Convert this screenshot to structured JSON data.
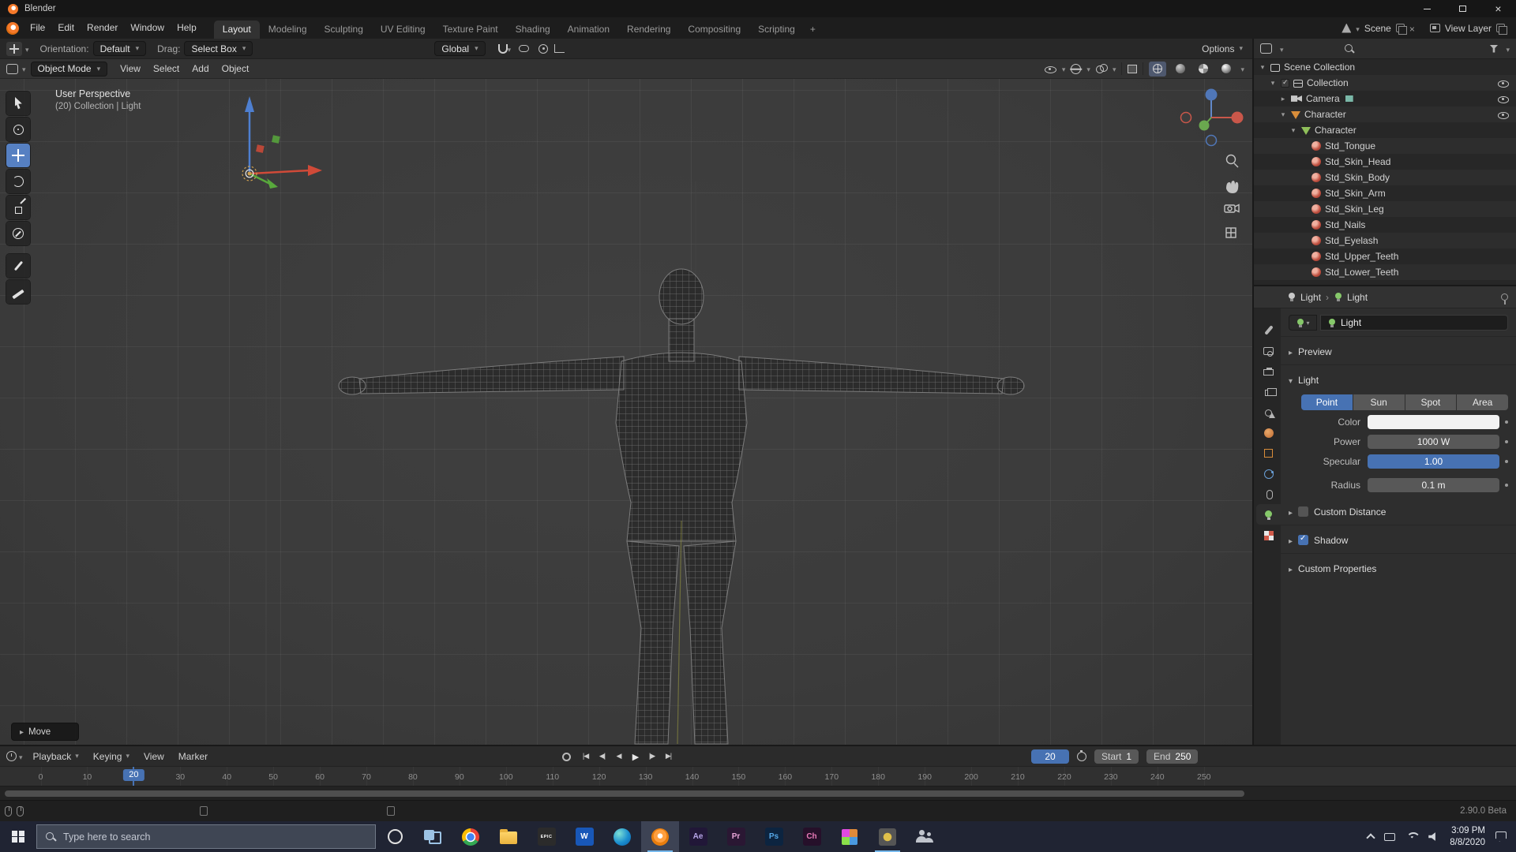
{
  "window": {
    "title": "Blender"
  },
  "topbar": {
    "menus": [
      "File",
      "Edit",
      "Render",
      "Window",
      "Help"
    ],
    "tabs": [
      "Layout",
      "Modeling",
      "Sculpting",
      "UV Editing",
      "Texture Paint",
      "Shading",
      "Animation",
      "Rendering",
      "Compositing",
      "Scripting"
    ],
    "active_tab": "Layout",
    "add_tab": "+",
    "scene_label": "Scene",
    "view_layer_label": "View Layer"
  },
  "tool_settings": {
    "orientation_label": "Orientation:",
    "orientation_value": "Default",
    "drag_label": "Drag:",
    "drag_value": "Select Box",
    "transform_orientation": "Global",
    "options_label": "Options"
  },
  "viewport_header": {
    "mode": "Object Mode",
    "menus": [
      "View",
      "Select",
      "Add",
      "Object"
    ]
  },
  "viewport": {
    "perspective_label": "User Perspective",
    "context_label": "(20) Collection | Light",
    "operator_panel_label": "Move"
  },
  "tools": [
    {
      "name": "select-box-tool",
      "active": false
    },
    {
      "name": "cursor-tool",
      "active": false
    },
    {
      "name": "move-tool",
      "active": true
    },
    {
      "name": "rotate-tool",
      "active": false
    },
    {
      "name": "scale-tool",
      "active": false
    },
    {
      "name": "transform-tool",
      "active": false
    },
    {
      "name": "annotate-tool",
      "active": false
    },
    {
      "name": "measure-tool",
      "active": false
    }
  ],
  "outliner": {
    "rows": [
      {
        "label": "Scene Collection",
        "depth": 0,
        "icon": "scene-collection",
        "caret": "down",
        "eye": false
      },
      {
        "label": "Collection",
        "depth": 1,
        "icon": "collection",
        "caret": "down",
        "eye": true,
        "checkbox": true
      },
      {
        "label": "Camera",
        "depth": 2,
        "icon": "camera",
        "caret": "right",
        "eye": true,
        "badge": true
      },
      {
        "label": "Character",
        "depth": 2,
        "icon": "collection-orange",
        "caret": "down",
        "eye": true
      },
      {
        "label": "Character",
        "depth": 3,
        "icon": "mesh-green",
        "caret": "down",
        "eye": false
      },
      {
        "label": "Std_Tongue",
        "depth": 4,
        "icon": "material",
        "eye": false
      },
      {
        "label": "Std_Skin_Head",
        "depth": 4,
        "icon": "material",
        "eye": false
      },
      {
        "label": "Std_Skin_Body",
        "depth": 4,
        "icon": "material",
        "eye": false
      },
      {
        "label": "Std_Skin_Arm",
        "depth": 4,
        "icon": "material",
        "eye": false
      },
      {
        "label": "Std_Skin_Leg",
        "depth": 4,
        "icon": "material",
        "eye": false
      },
      {
        "label": "Std_Nails",
        "depth": 4,
        "icon": "material",
        "eye": false
      },
      {
        "label": "Std_Eyelash",
        "depth": 4,
        "icon": "material",
        "eye": false
      },
      {
        "label": "Std_Upper_Teeth",
        "depth": 4,
        "icon": "material",
        "eye": false
      },
      {
        "label": "Std_Lower_Teeth",
        "depth": 4,
        "icon": "material",
        "eye": false
      }
    ]
  },
  "properties": {
    "tabs": [
      {
        "name": "tool",
        "active": false
      },
      {
        "name": "render",
        "active": false
      },
      {
        "name": "output",
        "active": false
      },
      {
        "name": "view-layer",
        "active": false
      },
      {
        "name": "scene",
        "active": false
      },
      {
        "name": "world",
        "active": false
      },
      {
        "name": "object",
        "active": false
      },
      {
        "name": "physics",
        "active": false
      },
      {
        "name": "constraints",
        "active": false
      },
      {
        "name": "object-data",
        "active": true
      },
      {
        "name": "texture",
        "active": false
      }
    ],
    "breadcrumb_first": "Light",
    "breadcrumb_second": "Light",
    "name_value": "Light",
    "preview_section": "Preview",
    "light_section": "Light",
    "light_types": [
      {
        "label": "Point",
        "active": true
      },
      {
        "label": "Sun",
        "active": false
      },
      {
        "label": "Spot",
        "active": false
      },
      {
        "label": "Area",
        "active": false
      }
    ],
    "color_label": "Color",
    "power_label": "Power",
    "power_value": "1000 W",
    "specular_label": "Specular",
    "specular_value": "1.00",
    "radius_label": "Radius",
    "radius_value": "0.1 m",
    "custom_distance_section": "Custom Distance",
    "shadow_section": "Shadow",
    "custom_properties_section": "Custom Properties"
  },
  "timeline": {
    "menus": [
      "Playback",
      "Keying",
      "View",
      "Marker"
    ],
    "transport": [
      {
        "name": "jump-to-start",
        "glyph": "|◀"
      },
      {
        "name": "prev-keyframe",
        "glyph": "◀|"
      },
      {
        "name": "play-reverse",
        "glyph": "◀"
      },
      {
        "name": "play",
        "glyph": "▶"
      },
      {
        "name": "next-keyframe",
        "glyph": "|▶"
      },
      {
        "name": "jump-to-end",
        "glyph": "▶|"
      }
    ],
    "current_frame": "20",
    "start_label": "Start",
    "start_value": "1",
    "end_label": "End",
    "end_value": "250",
    "ticks": [
      0,
      10,
      20,
      30,
      40,
      50,
      60,
      70,
      80,
      90,
      100,
      110,
      120,
      130,
      140,
      150,
      160,
      170,
      180,
      190,
      200,
      210,
      220,
      230,
      240,
      250
    ]
  },
  "statusbar": {
    "version": "2.90.0 Beta"
  },
  "taskbar": {
    "search_placeholder": "Type here to search",
    "apps": [
      {
        "name": "browser-circle",
        "type": "ring"
      },
      {
        "name": "task-view",
        "type": "taskview"
      },
      {
        "name": "chrome",
        "type": "chrome"
      },
      {
        "name": "file-explorer",
        "type": "folder"
      },
      {
        "name": "epic-games",
        "type": "tile",
        "glyph": "EPIC",
        "bg": "#2b2b2b",
        "fg": "#ffffff",
        "small": true
      },
      {
        "name": "word",
        "type": "tile",
        "glyph": "W",
        "bg": "#1857b8",
        "fg": "#ffffff"
      },
      {
        "name": "edge",
        "type": "edge"
      },
      {
        "name": "blender",
        "type": "blender",
        "open": true,
        "focused": true
      },
      {
        "name": "after-effects",
        "type": "tile",
        "glyph": "Ae",
        "bg": "#211738",
        "fg": "#b6a6e8"
      },
      {
        "name": "premiere",
        "type": "tile",
        "glyph": "Pr",
        "bg": "#2a1733",
        "fg": "#e8a6d8"
      },
      {
        "name": "photoshop",
        "type": "tile",
        "glyph": "Ps",
        "bg": "#0c2440",
        "fg": "#55a8e8"
      },
      {
        "name": "character-animator",
        "type": "tile",
        "glyph": "Ch",
        "bg": "#26102a",
        "fg": "#e87ab8"
      },
      {
        "name": "game-app",
        "type": "pixel"
      },
      {
        "name": "media-app",
        "type": "pixel2",
        "open": true
      },
      {
        "name": "people",
        "type": "people"
      }
    ],
    "time": "3:09 PM",
    "date": "8/8/2020"
  }
}
